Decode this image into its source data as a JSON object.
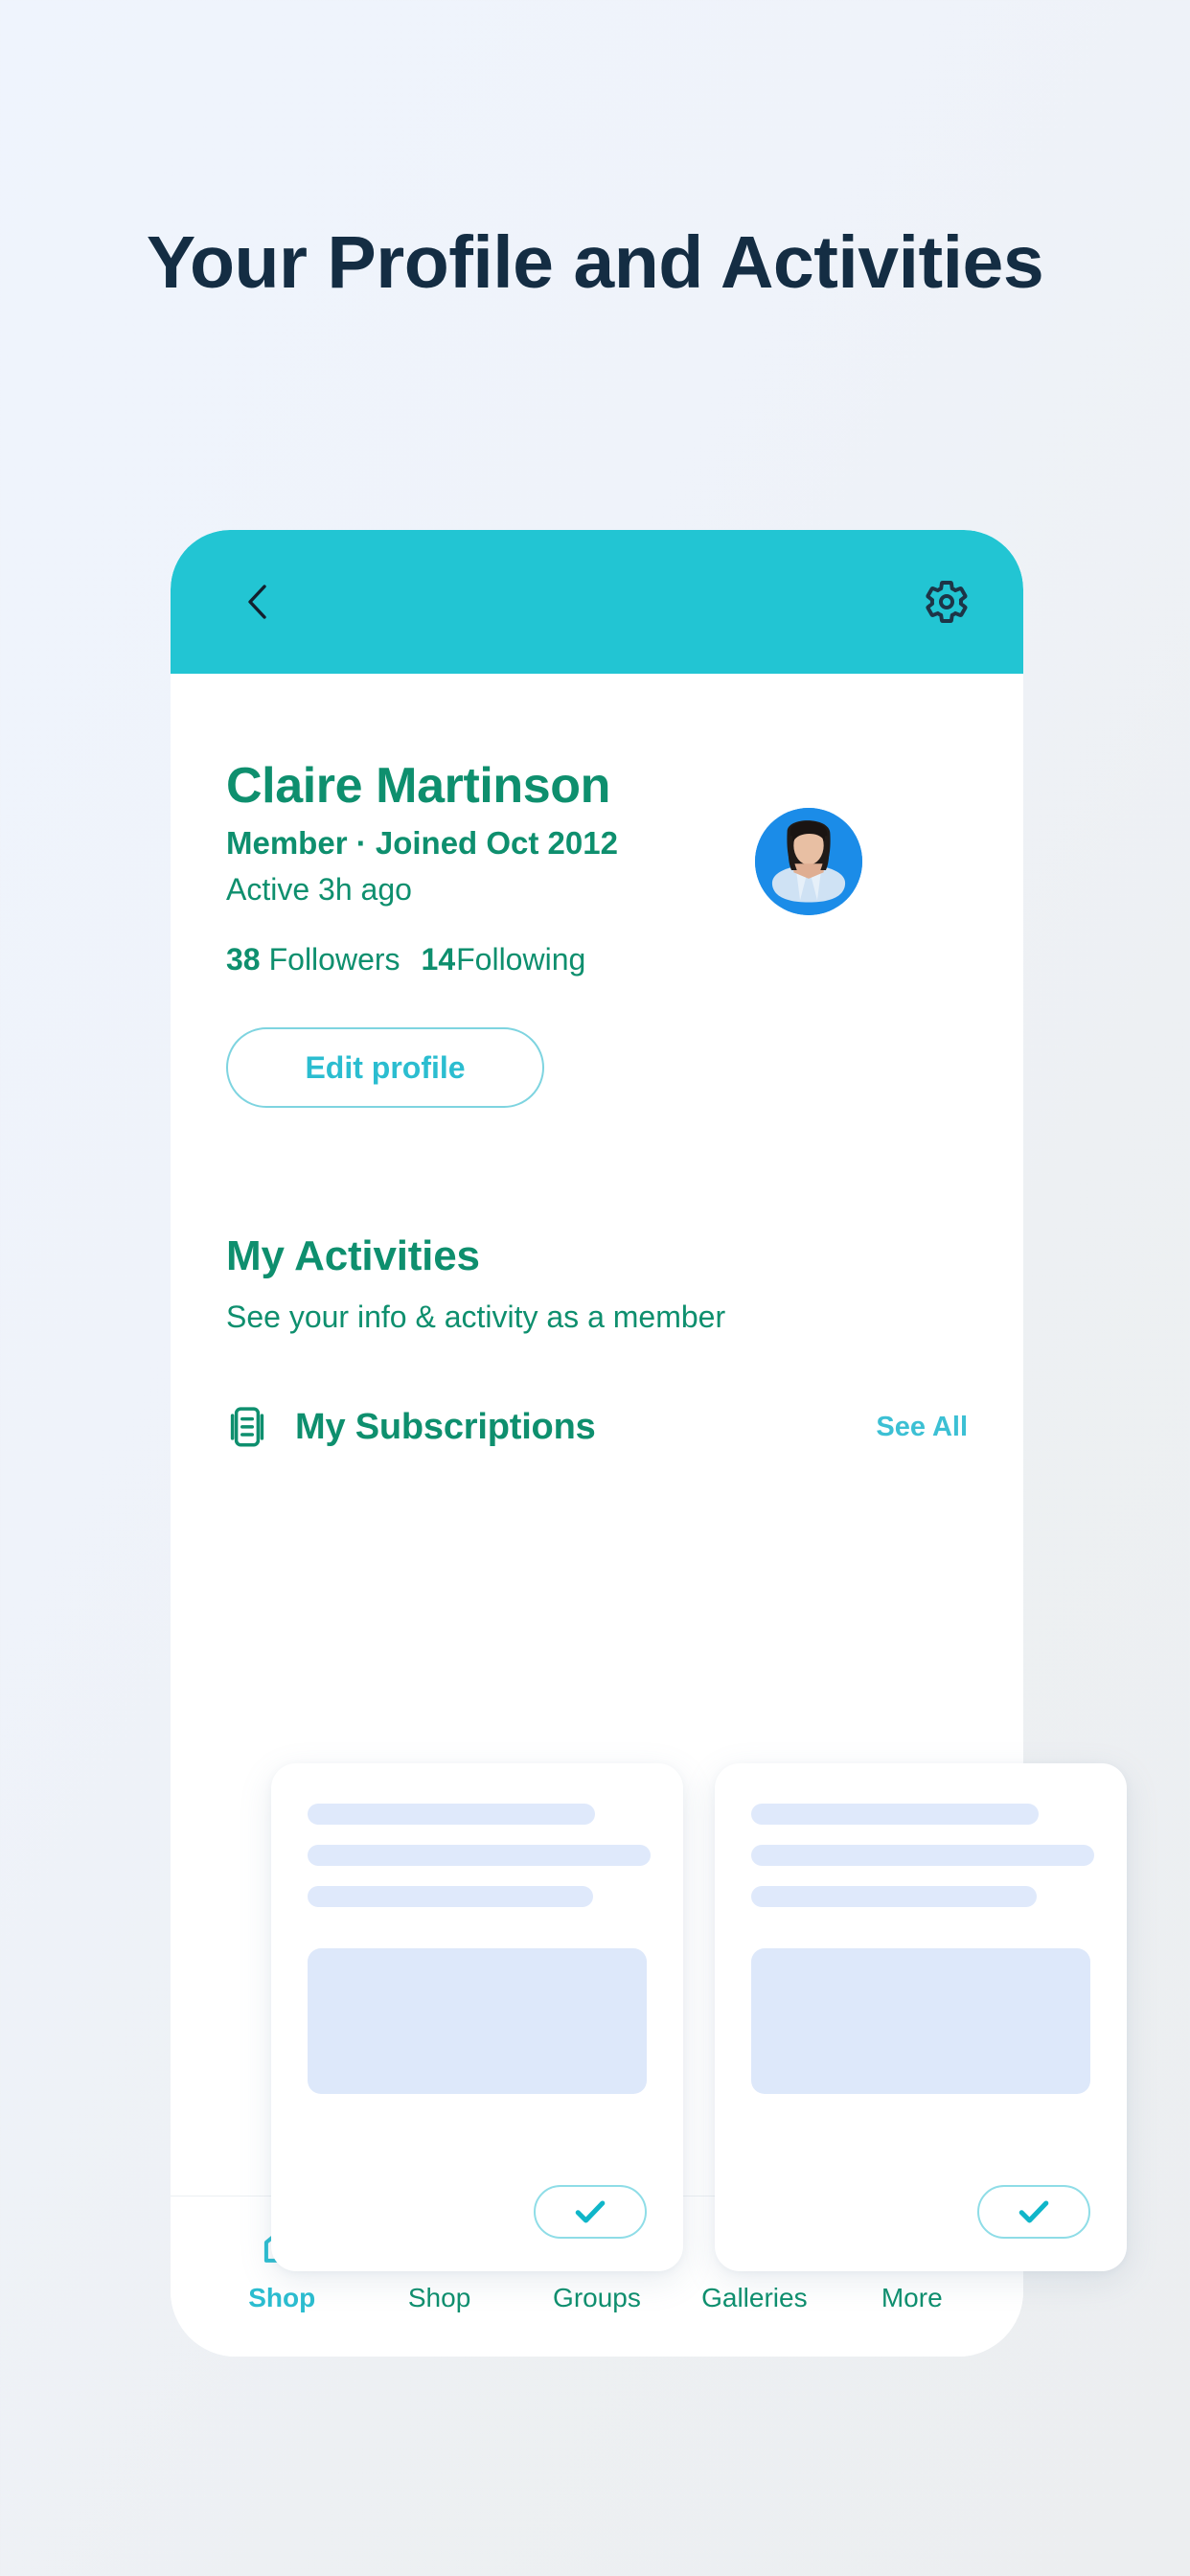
{
  "page": {
    "heading": "Your Profile and Activities"
  },
  "colors": {
    "teal_header": "#22C5D3",
    "accent_teal": "#2BBDD0",
    "green_text": "#0E8F6E",
    "heading_navy": "#142D43",
    "skeleton_blue": "#DFE9FB",
    "avatar_bg": "#1B8CE8",
    "see_all": "#3CC0D4"
  },
  "app_header": {
    "back_icon": "chevron-left-icon",
    "settings_icon": "gear-icon"
  },
  "profile": {
    "name": "Claire Martinson",
    "meta": "Member · Joined Oct 2012",
    "active": "Active 3h ago",
    "followers_count": "38",
    "followers_label": "Followers",
    "following_count": "14",
    "following_label": "Following",
    "edit_button": "Edit profile",
    "avatar_icon": "avatar"
  },
  "activities": {
    "title": "My Activities",
    "subtitle": "See your info & activity as a member"
  },
  "subscriptions": {
    "icon": "document-list-icon",
    "title": "My Subscriptions",
    "see_all": "See All",
    "cards": [
      {
        "check_icon": "check-icon",
        "lines": 3
      },
      {
        "check_icon": "check-icon",
        "lines": 3
      }
    ]
  },
  "bottom_nav": {
    "items": [
      {
        "label": "Shop",
        "icon": "home-icon",
        "active": true
      },
      {
        "label": "Shop",
        "icon": "gift-icon",
        "active": false
      },
      {
        "label": "Groups",
        "icon": "people-icon",
        "active": false
      },
      {
        "label": "Galleries",
        "icon": "image-icon",
        "active": false
      },
      {
        "label": "More",
        "icon": "hamburger-menu-icon",
        "active": false
      }
    ]
  }
}
